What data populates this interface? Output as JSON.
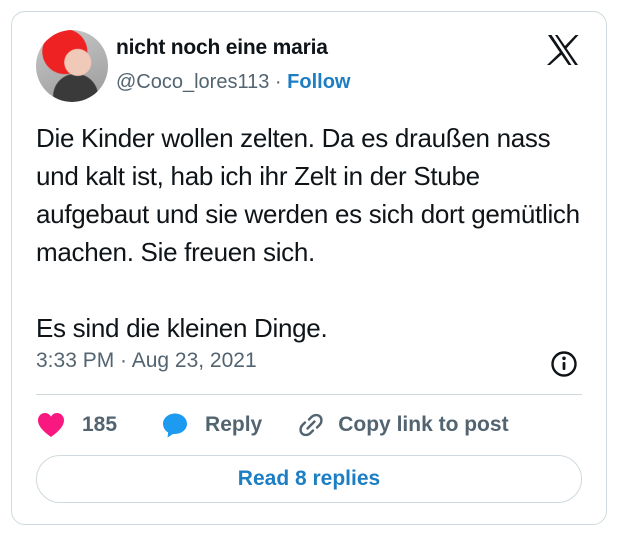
{
  "author": {
    "display_name": "nicht noch eine maria",
    "handle": "@Coco_lores113",
    "separator": "·",
    "follow_label": "Follow"
  },
  "post": {
    "paragraphs": [
      "Die Kinder wollen zelten. Da es draußen nass und kalt ist, hab ich ihr Zelt in der Stube aufgebaut und sie werden es sich dort gemütlich machen. Sie freuen sich.",
      "Es sind die kleinen Dinge."
    ],
    "timestamp": "3:33 PM · Aug 23, 2021"
  },
  "actions": {
    "like_count": "185",
    "reply_label": "Reply",
    "copy_label": "Copy link to post"
  },
  "read_replies_label": "Read 8 replies",
  "icons": {
    "brand": "x-logo-icon",
    "info": "info-icon",
    "like": "heart-icon",
    "reply": "speech-bubble-icon",
    "copy": "link-icon"
  },
  "colors": {
    "accent": "#1d7ec4",
    "heart": "#f91880",
    "muted": "#536471",
    "border": "#cfd9de"
  }
}
